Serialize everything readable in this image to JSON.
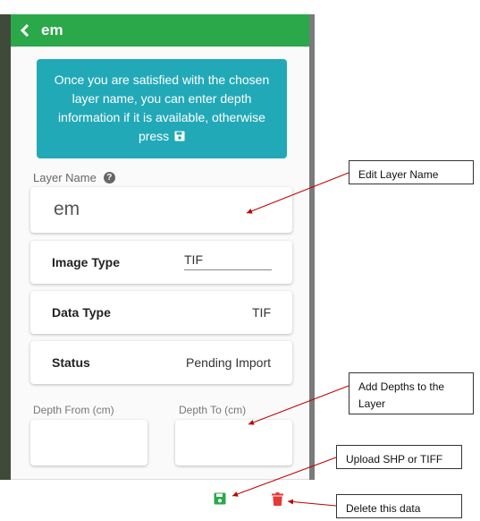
{
  "header": {
    "title": "em"
  },
  "info": {
    "message": "Once you are satisfied with the chosen layer name, you can enter depth information if it is available, otherwise press"
  },
  "layer": {
    "label": "Layer Name",
    "value": "em"
  },
  "fields": {
    "image_type": {
      "label": "Image Type",
      "value": "TIF"
    },
    "data_type": {
      "label": "Data Type",
      "value": "TIF"
    },
    "status": {
      "label": "Status",
      "value": "Pending Import"
    }
  },
  "depth": {
    "from_label": "Depth From (cm)",
    "to_label": "Depth To (cm)",
    "from_value": "",
    "to_value": ""
  },
  "callouts": {
    "edit_layer": "Edit Layer Name",
    "add_depths": "Add Depths to the Layer",
    "upload": "Upload SHP or TIFF",
    "delete": "Delete this data"
  },
  "colors": {
    "header": "#2ba84a",
    "info": "#22a9b8",
    "save": "#2ba84a",
    "delete": "#e53935",
    "arrow": "#c00000"
  },
  "icons": {
    "back": "chevron-left-icon",
    "help": "question-circle-icon",
    "save": "floppy-disk-icon",
    "delete": "trash-icon"
  }
}
